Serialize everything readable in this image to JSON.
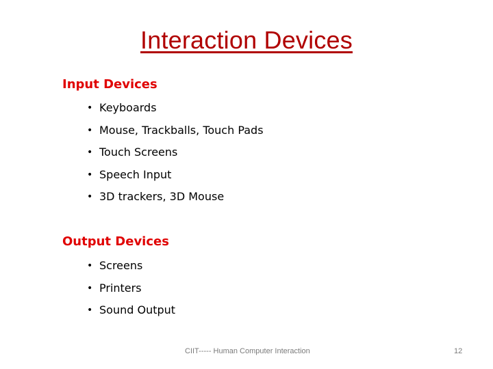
{
  "slide": {
    "title": "Interaction Devices",
    "sections": [
      {
        "heading": "Input Devices",
        "items": [
          "Keyboards",
          "Mouse, Trackballs, Touch Pads",
          "Touch Screens",
          "Speech Input",
          "3D trackers, 3D Mouse"
        ]
      },
      {
        "heading": "Output Devices",
        "items": [
          "Screens",
          "Printers",
          "Sound Output"
        ]
      }
    ],
    "bullet_glyph": "•",
    "footer": "CIIT----- Human Computer Interaction",
    "page_number": "12",
    "colors": {
      "title": "#b00000",
      "heading": "#e00000",
      "footer": "#7a7a7a"
    }
  }
}
